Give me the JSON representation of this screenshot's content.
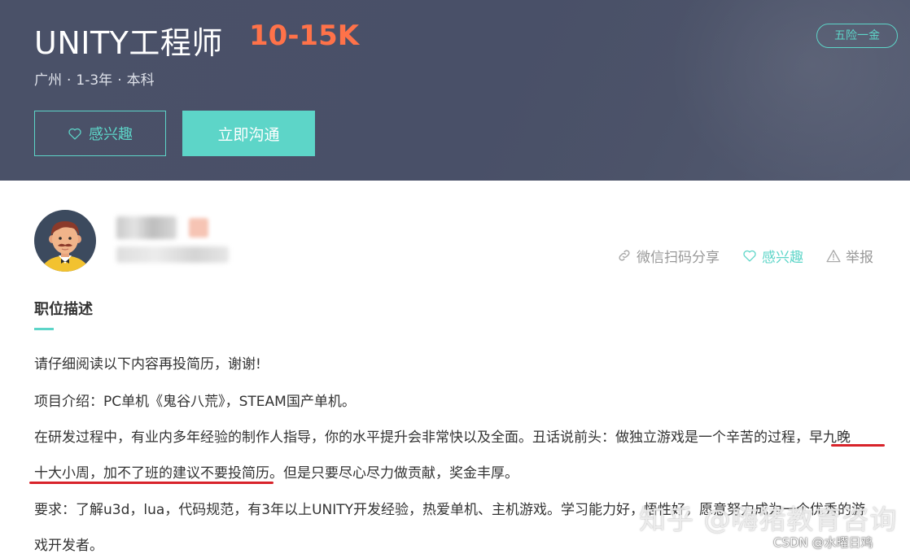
{
  "job": {
    "title": "UNITY工程师",
    "salary": "10-15K",
    "location": "广州",
    "experience": "1-3年",
    "education": "本科",
    "separator": "·",
    "benefit_tag": "五险一金"
  },
  "buttons": {
    "interest": "感兴趣",
    "chat": "立即沟通"
  },
  "actions": {
    "share": "微信扫码分享",
    "interest": "感兴趣",
    "report": "举报"
  },
  "description": {
    "title": "职位描述",
    "lines": [
      "请仔细阅读以下内容再投简历，谢谢!",
      "项目介绍：PC单机《鬼谷八荒》，STEAM国产单机。",
      "在研发过程中，有业内多年经验的制作人指导，你的水平提升会非常快以及全面。丑话说前头：做独立游戏是一个辛苦的过程，早九晚",
      "十大小周，加不了班的建议不要投简历。但是只要尽心尽力做贡献，奖金丰厚。",
      "要求：了解u3d，lua，代码规范，有3年以上UNITY开发经验，热爱单机、主机游戏。学习能力好，悟性好，愿意努力成为一个优秀的游",
      "戏开发者。"
    ]
  },
  "watermarks": {
    "zhihu": "知乎 @嗨猪教育咨询",
    "csdn": "CSDN @水曜日鸡"
  },
  "colors": {
    "header_bg": "#495068",
    "accent": "#5dd5c8",
    "salary": "#ff7249",
    "highlight_underline": "#d8232a"
  },
  "icons": {
    "interest": "heart-outline-icon",
    "share": "link-icon",
    "report": "warning-triangle-icon"
  }
}
